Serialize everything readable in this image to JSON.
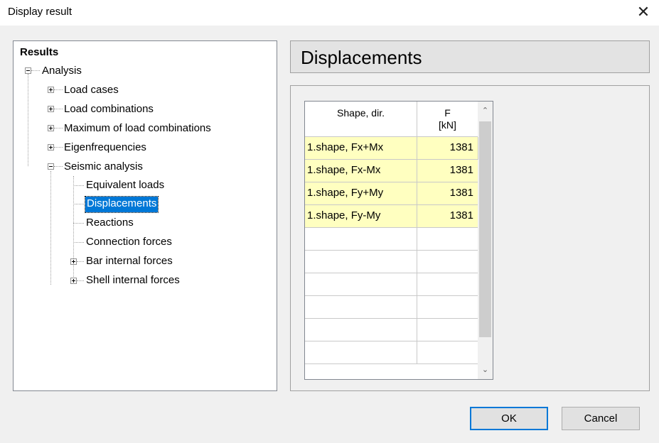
{
  "window": {
    "title": "Display result",
    "close_glyph": "✕"
  },
  "tree": {
    "root": "Results",
    "analysis": "Analysis",
    "load_cases": "Load cases",
    "load_combinations": "Load combinations",
    "max_load_combinations": "Maximum of load combinations",
    "eigenfrequencies": "Eigenfrequencies",
    "seismic_analysis": "Seismic analysis",
    "equivalent_loads": "Equivalent loads",
    "displacements": "Displacements",
    "reactions": "Reactions",
    "connection_forces": "Connection forces",
    "bar_internal_forces": "Bar internal forces",
    "shell_internal_forces": "Shell internal forces"
  },
  "header": {
    "title": "Displacements"
  },
  "grid": {
    "col1_header": "Shape, dir.",
    "col2_header_line1": "F",
    "col2_header_line2": "[kN]",
    "rows": [
      {
        "shape": "1.shape, Fx+Mx",
        "value": "1381"
      },
      {
        "shape": "1.shape, Fx-Mx",
        "value": "1381"
      },
      {
        "shape": "1.shape, Fy+My",
        "value": "1381"
      },
      {
        "shape": "1.shape, Fy-My",
        "value": "1381"
      }
    ],
    "scroll_up": "⌃",
    "scroll_down": "⌄"
  },
  "buttons": {
    "ok": "OK",
    "cancel": "Cancel"
  },
  "colors": {
    "selection": "#0078d7",
    "row_fill": "#ffffc0"
  }
}
